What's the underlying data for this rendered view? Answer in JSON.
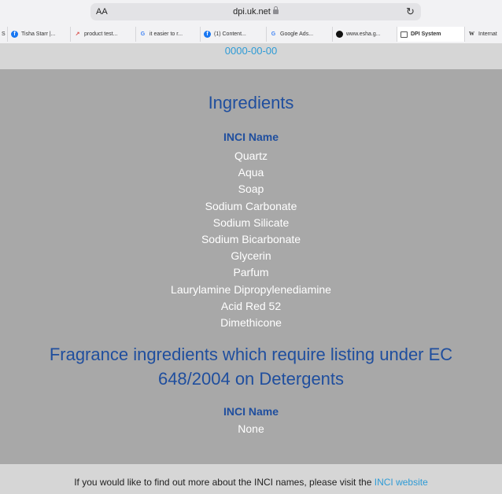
{
  "browser": {
    "text_size_label": "AA",
    "url": "dpi.uk.net",
    "tabs": [
      {
        "icon": "facebook-icon",
        "label": "Tisha Starr |..."
      },
      {
        "icon": "chart-icon",
        "label": "product test..."
      },
      {
        "icon": "google-icon",
        "label": "it easier to r..."
      },
      {
        "icon": "facebook-icon",
        "label": "(1) Content..."
      },
      {
        "icon": "google-icon",
        "label": "Google Ads..."
      },
      {
        "icon": "github-icon",
        "label": "www.esha.g..."
      },
      {
        "icon": "document-icon",
        "label": "DPI System"
      },
      {
        "icon": "wikipedia-icon",
        "label": "Internat"
      }
    ]
  },
  "page": {
    "date": "0000-00-00",
    "ingredients_heading": "Ingredients",
    "inci_name_label": "INCI Name",
    "ingredients": [
      "Quartz",
      "Aqua",
      "Soap",
      "Sodium Carbonate",
      "Sodium Silicate",
      "Sodium Bicarbonate",
      "Glycerin",
      "Parfum",
      "Laurylamine Dipropylenediamine",
      "Acid Red 52",
      "Dimethicone"
    ],
    "fragrance_heading": "Fragrance ingredients which require listing under EC 648/2004 on Detergents",
    "fragrance_inci_label": "INCI Name",
    "fragrance_value": "None"
  },
  "footer": {
    "text": "If you would like to find out more about the INCI names, please visit the ",
    "link_label": "INCI website"
  },
  "colors": {
    "heading": "#1f4e9e",
    "link": "#2e9bd6",
    "background": "#a8a8a8"
  }
}
